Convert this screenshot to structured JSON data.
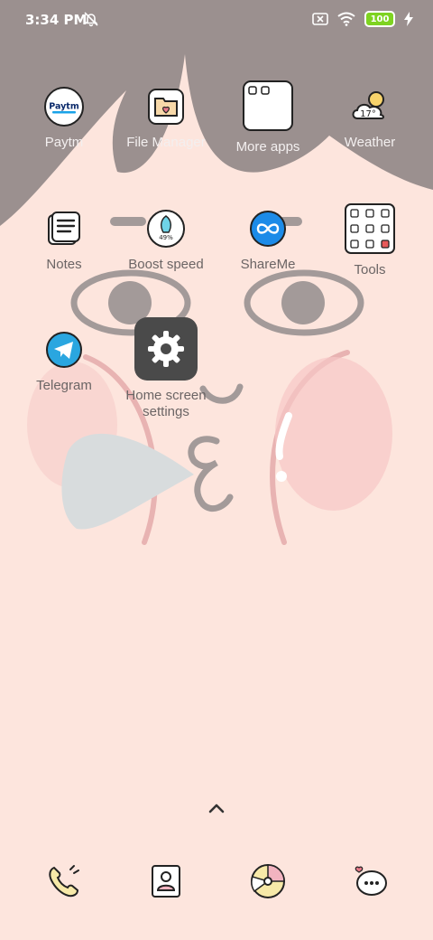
{
  "status_bar": {
    "time": "3:34 PM",
    "battery": "100"
  },
  "apps": [
    {
      "label": "Paytm",
      "icon": "paytm-icon",
      "logo_text": "Paytm"
    },
    {
      "label": "File Manager",
      "icon": "file-manager-icon"
    },
    {
      "label": "More apps",
      "icon": "more-apps-icon"
    },
    {
      "label": "Weather",
      "icon": "weather-icon",
      "temp": "17°"
    },
    {
      "label": "Notes",
      "icon": "notes-icon"
    },
    {
      "label": "Boost speed",
      "icon": "boost-speed-icon",
      "percent": "49%"
    },
    {
      "label": "ShareMe",
      "icon": "shareme-icon"
    },
    {
      "label": "Tools",
      "icon": "tools-icon"
    },
    {
      "label": "Telegram",
      "icon": "telegram-icon"
    }
  ],
  "context_action": {
    "label": "Home screen settings",
    "icon": "gear-icon"
  },
  "dock": [
    "phone-icon",
    "contacts-icon",
    "browser-icon",
    "messages-icon"
  ],
  "colors": {
    "background": "#fde5dd",
    "hair": "#9b908f",
    "accent_tile": "#4a4a4a"
  }
}
